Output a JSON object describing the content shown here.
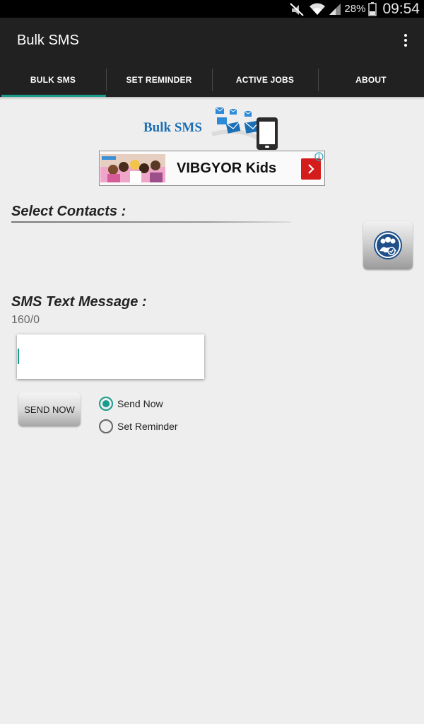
{
  "status_bar": {
    "battery_percent": "28%",
    "time": "09:54",
    "icons": [
      "notifications-muted-icon",
      "wifi-icon",
      "cellular-signal-icon",
      "battery-icon"
    ]
  },
  "app": {
    "title": "Bulk SMS"
  },
  "tabs": [
    {
      "label": "BULK SMS",
      "active": true
    },
    {
      "label": "SET REMINDER",
      "active": false
    },
    {
      "label": "ACTIVE JOBS",
      "active": false
    },
    {
      "label": "ABOUT",
      "active": false
    }
  ],
  "logo": {
    "text": "Bulk SMS"
  },
  "ad": {
    "title": "VIBGYOR Kids"
  },
  "contacts": {
    "label": "Select Contacts  :"
  },
  "message": {
    "label": "SMS Text Message :",
    "counter": "160/0",
    "value": ""
  },
  "actions": {
    "send_label": "SEND NOW",
    "options": [
      {
        "label": "Send Now",
        "selected": true
      },
      {
        "label": "Set Reminder",
        "selected": false
      }
    ]
  },
  "colors": {
    "accent": "#1a9c8c",
    "toolbar": "#212121",
    "logo_blue": "#1b6fb5",
    "ad_red": "#d51c1c"
  }
}
